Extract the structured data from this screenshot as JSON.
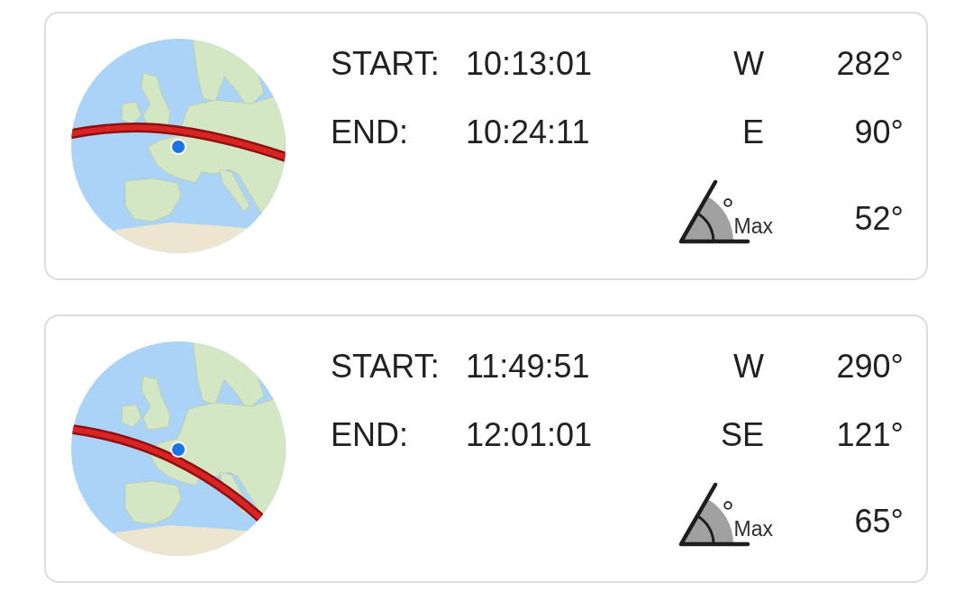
{
  "passes": [
    {
      "start": {
        "label": "START:",
        "time": "10:13:01",
        "direction": "W",
        "azimuth": "282°"
      },
      "end": {
        "label": "END:",
        "time": "10:24:11",
        "direction": "E",
        "azimuth": "90°"
      },
      "max_elevation": {
        "label": "Max",
        "value": "52°"
      }
    },
    {
      "start": {
        "label": "START:",
        "time": "11:49:51",
        "direction": "W",
        "azimuth": "290°"
      },
      "end": {
        "label": "END:",
        "time": "12:01:01",
        "direction": "SE",
        "azimuth": "121°"
      },
      "max_elevation": {
        "label": "Max",
        "value": "65°"
      }
    }
  ]
}
